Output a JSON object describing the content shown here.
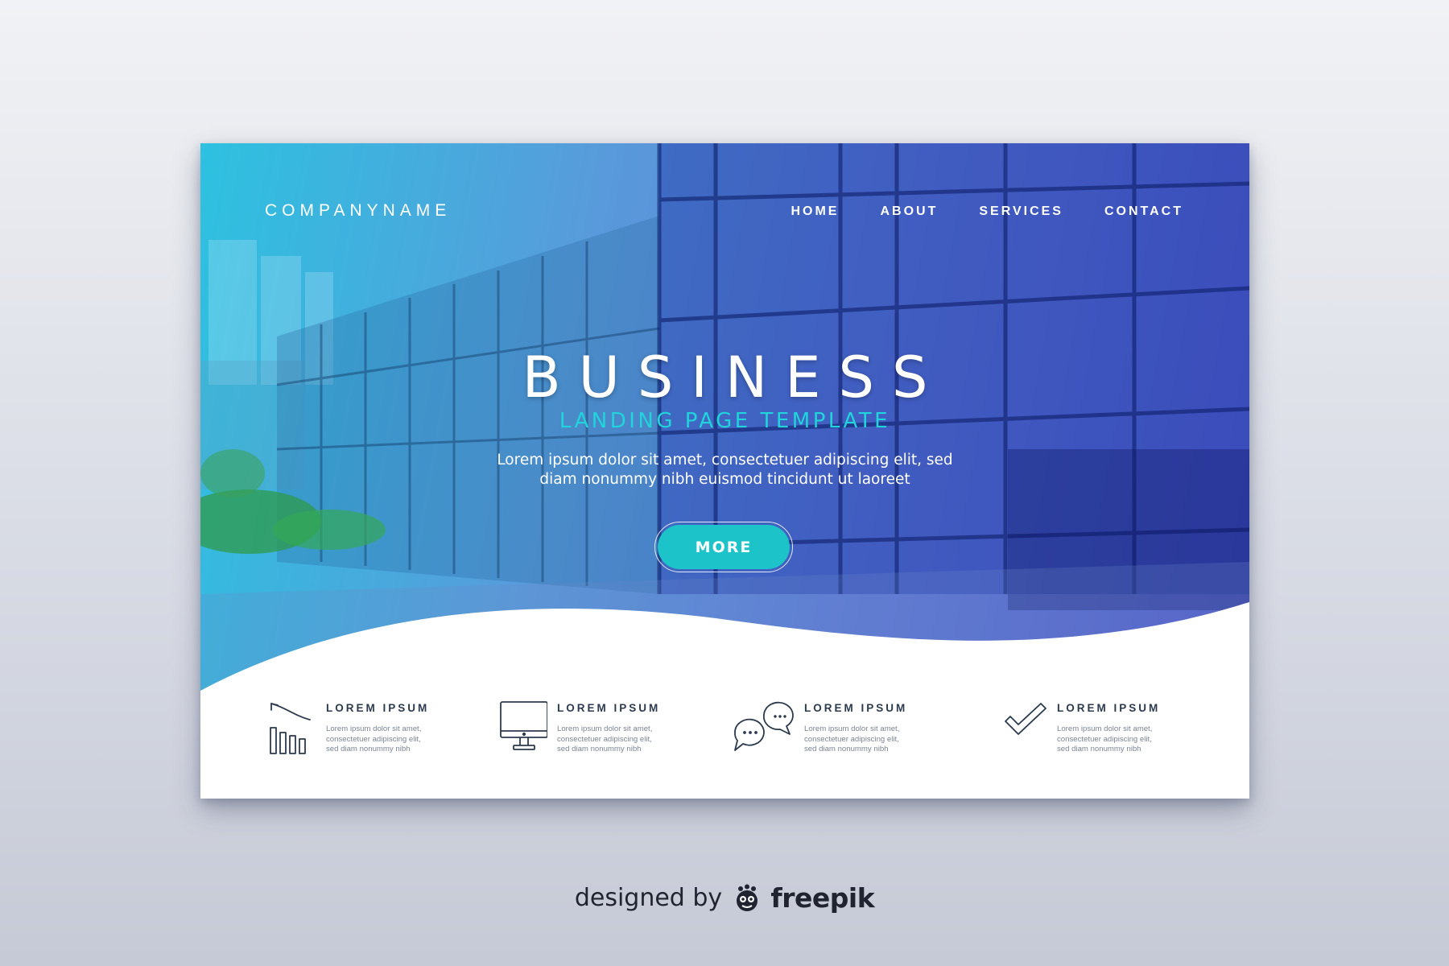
{
  "header": {
    "logo": "COMPANYNAME",
    "nav": [
      "HOME",
      "ABOUT",
      "SERVICES",
      "CONTACT"
    ]
  },
  "hero": {
    "headline": "BUSINESS",
    "subheadline": "LANDING PAGE TEMPLATE",
    "description_lines": [
      "Lorem ipsum dolor sit amet, consectetuer adipiscing elit, sed",
      "diam nonummy nibh euismod tincidunt ut laoreet"
    ],
    "cta_label": "MORE"
  },
  "features": [
    {
      "icon": "bar-chart-icon",
      "title": "LOREM IPSUM",
      "lines": [
        "Lorem ipsum dolor sit amet,",
        "consectetuer adipiscing elit,",
        "sed diam nonummy nibh"
      ]
    },
    {
      "icon": "monitor-icon",
      "title": "LOREM IPSUM",
      "lines": [
        "Lorem ipsum dolor sit amet,",
        "consectetuer adipiscing elit,",
        "sed diam nonummy nibh"
      ]
    },
    {
      "icon": "chat-bubbles-icon",
      "title": "LOREM IPSUM",
      "lines": [
        "Lorem ipsum dolor sit amet,",
        "consectetuer adipiscing elit,",
        "sed diam nonummy nibh"
      ]
    },
    {
      "icon": "checkmark-icon",
      "title": "LOREM IPSUM",
      "lines": [
        "Lorem ipsum dolor sit amet,",
        "consectetuer adipiscing elit,",
        "sed diam nonummy nibh"
      ]
    }
  ],
  "credit": {
    "prefix": "designed by",
    "brand": "freepik"
  },
  "colors": {
    "accent": "#1cc3c9",
    "subheadline": "#1fd4da",
    "hero_left": "#22bede",
    "hero_right": "#323cbe"
  }
}
